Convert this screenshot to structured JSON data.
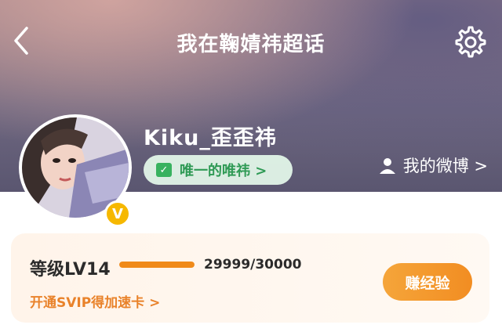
{
  "header": {
    "title": "我在鞠婧祎超话",
    "back_icon": "chevron-left-icon",
    "settings_icon": "gear-icon"
  },
  "profile": {
    "name": "Kiku_歪歪祎",
    "fan_tag_label": "唯一的唯祎 >",
    "badge_letter": "V",
    "weibo_link_label": "我的微博 >"
  },
  "level_card": {
    "level_label": "等级LV14",
    "progress_text": "29999/30000",
    "progress_fraction": 0.9999,
    "svip_link": "开通SVIP得加速卡 >",
    "earn_button": "赚经验"
  },
  "colors": {
    "accent_orange": "#f28d22",
    "fan_tag_green": "#2f9a55",
    "badge_yellow": "#f6b800"
  }
}
